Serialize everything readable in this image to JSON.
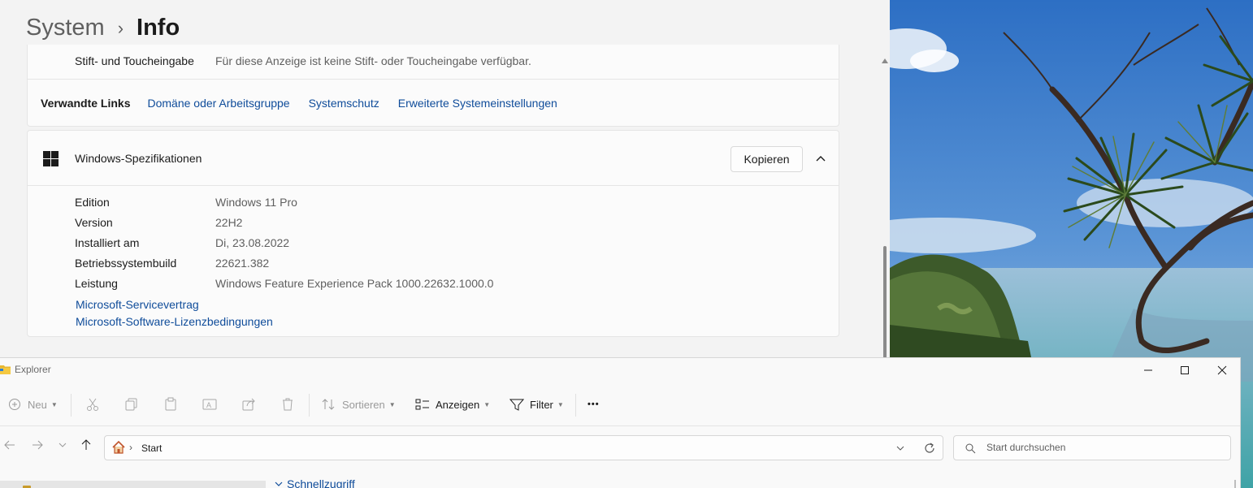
{
  "settings": {
    "breadcrumb": {
      "parent": "System",
      "separator": "›",
      "current": "Info"
    },
    "top_card": {
      "partial_row": {
        "label": "Stift- und Toucheingabe",
        "value": "Für diese Anzeige ist keine Stift- oder Toucheingabe verfügbar."
      },
      "related_title": "Verwandte Links",
      "related_links": [
        "Domäne oder Arbeitsgruppe",
        "Systemschutz",
        "Erweiterte Systemeinstellungen"
      ]
    },
    "windows_specs": {
      "title": "Windows-Spezifikationen",
      "copy_label": "Kopieren",
      "rows": [
        {
          "label": "Edition",
          "value": "Windows 11 Pro"
        },
        {
          "label": "Version",
          "value": "22H2"
        },
        {
          "label": "Installiert am",
          "value": "Di, 23.08.2022"
        },
        {
          "label": "Betriebssystembuild",
          "value": "22621.382"
        },
        {
          "label": "Leistung",
          "value": "Windows Feature Experience Pack 1000.22632.1000.0"
        }
      ],
      "links": [
        "Microsoft-Servicevertrag",
        "Microsoft-Software-Lizenzbedingungen"
      ]
    }
  },
  "explorer": {
    "title": "Explorer",
    "toolbar": {
      "new_label": "Neu",
      "sort_label": "Sortieren",
      "view_label": "Anzeigen",
      "filter_label": "Filter",
      "more_label": "•••"
    },
    "address": {
      "location": "Start",
      "chevron": "›"
    },
    "search": {
      "placeholder": "Start durchsuchen"
    },
    "content_header": "Schnellzugriff"
  },
  "colors": {
    "accent_link": "#0f4c9a",
    "folder_yellow": "#e8b730"
  },
  "icons": [
    "windows-logo-icon",
    "chevron-up-icon",
    "folder-icon",
    "minimize-icon",
    "maximize-icon",
    "close-icon",
    "plus-icon",
    "cut-icon",
    "copy-icon",
    "paste-icon",
    "rename-icon",
    "share-icon",
    "delete-icon",
    "sort-icon",
    "view-icon",
    "filter-icon",
    "back-icon",
    "forward-icon",
    "recent-dropdown-icon",
    "up-icon",
    "home-icon",
    "refresh-icon",
    "search-icon"
  ]
}
